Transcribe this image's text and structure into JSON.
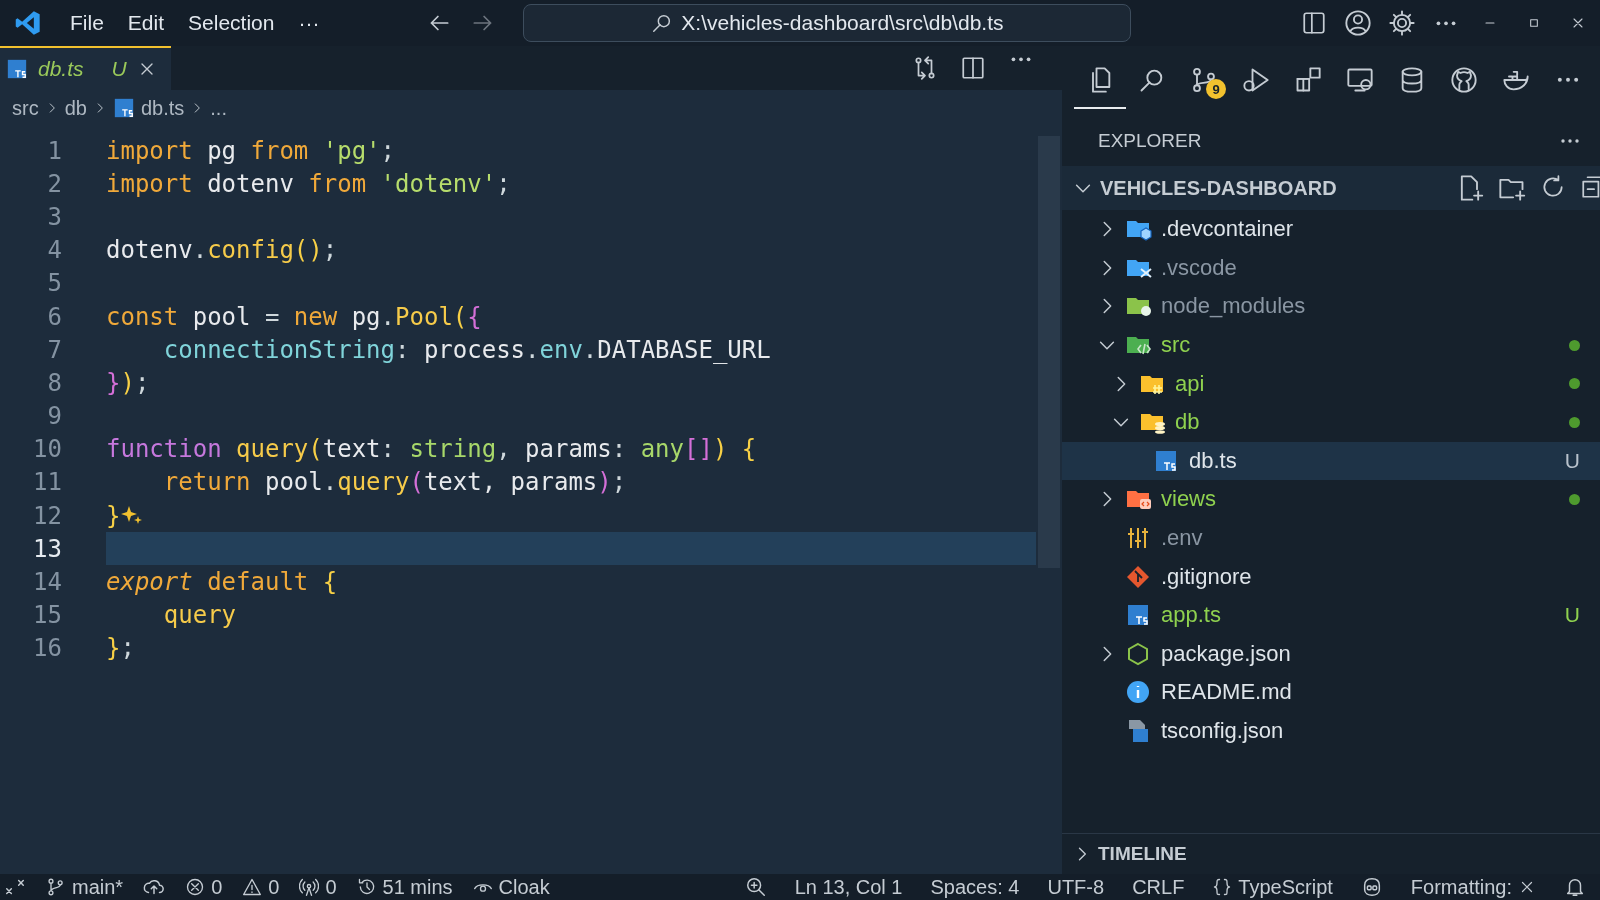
{
  "titlebar": {
    "menus": [
      "File",
      "Edit",
      "Selection",
      "···"
    ],
    "command_center": "X:\\vehicles-dashboard\\src\\db\\db.ts"
  },
  "tabs": [
    {
      "label": "db.ts",
      "badge": "U",
      "selected": true
    }
  ],
  "breadcrumbs": [
    "src",
    "db",
    "db.ts",
    "..."
  ],
  "editor": {
    "lines": [
      {
        "n": "1",
        "current": false,
        "sparkle": false,
        "tokens": [
          {
            "t": "import",
            "kind": "kw"
          },
          {
            "t": " pg ",
            "kind": "id"
          },
          {
            "t": "from",
            "kind": "kw"
          },
          {
            "t": " 'pg'",
            "kind": "str"
          },
          {
            "t": ";",
            "kind": "punct"
          }
        ]
      },
      {
        "n": "2",
        "current": false,
        "sparkle": false,
        "tokens": [
          {
            "t": "import",
            "kind": "kw"
          },
          {
            "t": " dotenv ",
            "kind": "id"
          },
          {
            "t": "from",
            "kind": "kw"
          },
          {
            "t": " 'dotenv'",
            "kind": "str"
          },
          {
            "t": ";",
            "kind": "punct"
          }
        ]
      },
      {
        "n": "3",
        "current": false,
        "sparkle": false
      },
      {
        "n": "4",
        "current": false,
        "sparkle": false,
        "tokens": [
          {
            "t": "dotenv",
            "kind": "id"
          },
          {
            "t": ".",
            "kind": "punct"
          },
          {
            "t": "config",
            "kind": "fn"
          },
          {
            "t": "()",
            "kind": "br1"
          },
          {
            "t": ";",
            "kind": "punct"
          }
        ]
      },
      {
        "n": "5",
        "current": false,
        "sparkle": false
      },
      {
        "n": "6",
        "current": false,
        "sparkle": false,
        "tokens": [
          {
            "t": "const",
            "kind": "kw"
          },
          {
            "t": " pool ",
            "kind": "id"
          },
          {
            "t": "= ",
            "kind": "punct"
          },
          {
            "t": "new",
            "kind": "kw"
          },
          {
            "t": " pg",
            "kind": "id"
          },
          {
            "t": ".",
            "kind": "punct"
          },
          {
            "t": "Pool",
            "kind": "fn"
          },
          {
            "t": "(",
            "kind": "br1"
          },
          {
            "t": "{",
            "kind": "br2"
          }
        ]
      },
      {
        "n": "7",
        "current": false,
        "sparkle": false,
        "tokens": [
          {
            "t": "    connectionString",
            "kind": "prop"
          },
          {
            "t": ": ",
            "kind": "punct"
          },
          {
            "t": "process",
            "kind": "id"
          },
          {
            "t": ".",
            "kind": "punct"
          },
          {
            "t": "env",
            "kind": "prop"
          },
          {
            "t": ".",
            "kind": "punct"
          },
          {
            "t": "DATABASE_URL",
            "kind": "id"
          }
        ]
      },
      {
        "n": "8",
        "current": false,
        "sparkle": false,
        "tokens": [
          {
            "t": "}",
            "kind": "br2"
          },
          {
            "t": ")",
            "kind": "br1"
          },
          {
            "t": ";",
            "kind": "punct"
          }
        ]
      },
      {
        "n": "9",
        "current": false,
        "sparkle": false
      },
      {
        "n": "10",
        "current": false,
        "sparkle": false,
        "tokens": [
          {
            "t": "function ",
            "kind": "fkw"
          },
          {
            "t": "query",
            "kind": "fn"
          },
          {
            "t": "(",
            "kind": "br1"
          },
          {
            "t": "text",
            "kind": "id"
          },
          {
            "t": ": ",
            "kind": "punct"
          },
          {
            "t": "string",
            "kind": "type"
          },
          {
            "t": ", ",
            "kind": "punct"
          },
          {
            "t": "params",
            "kind": "id"
          },
          {
            "t": ": ",
            "kind": "punct"
          },
          {
            "t": "any",
            "kind": "type"
          },
          {
            "t": "[]",
            "kind": "br2"
          },
          {
            "t": ") {",
            "kind": "br1"
          }
        ]
      },
      {
        "n": "11",
        "current": false,
        "sparkle": false,
        "tokens": [
          {
            "t": "    return",
            "kind": "kw"
          },
          {
            "t": " pool",
            "kind": "id"
          },
          {
            "t": ".",
            "kind": "punct"
          },
          {
            "t": "query",
            "kind": "fn"
          },
          {
            "t": "(",
            "kind": "br2"
          },
          {
            "t": "text, params",
            "kind": "id"
          },
          {
            "t": ")",
            "kind": "br2"
          },
          {
            "t": ";",
            "kind": "punct"
          }
        ]
      },
      {
        "n": "12",
        "current": false,
        "sparkle": true,
        "tokens": [
          {
            "t": "}",
            "kind": "br1"
          }
        ]
      },
      {
        "n": "13",
        "current": true,
        "sparkle": false
      },
      {
        "n": "14",
        "current": false,
        "sparkle": false,
        "tokens": [
          {
            "t": "export",
            "kind": "kwi"
          },
          {
            "t": " default ",
            "kind": "kw"
          },
          {
            "t": "{",
            "kind": "br1"
          }
        ]
      },
      {
        "n": "15",
        "current": false,
        "sparkle": false,
        "tokens": [
          {
            "t": "    query",
            "kind": "fn"
          }
        ]
      },
      {
        "n": "16",
        "current": false,
        "sparkle": false,
        "tokens": [
          {
            "t": "}",
            "kind": "br1"
          },
          {
            "t": ";",
            "kind": "punct"
          }
        ]
      }
    ]
  },
  "activity_bar": [
    {
      "kind": "files",
      "selected": true
    },
    {
      "kind": "search",
      "selected": false
    },
    {
      "kind": "scm",
      "selected": false,
      "badge": "9"
    },
    {
      "kind": "debug",
      "selected": false
    },
    {
      "kind": "extensions",
      "selected": false
    },
    {
      "kind": "remote",
      "selected": false
    },
    {
      "kind": "database",
      "selected": false
    },
    {
      "kind": "cat",
      "selected": false
    },
    {
      "kind": "whale",
      "selected": false
    },
    {
      "kind": "more",
      "selected": false
    }
  ],
  "explorer": {
    "title": "EXPLORER",
    "folder": "VEHICLES-DASHBOARD",
    "expanded": true,
    "timeline": "TIMELINE",
    "tree": [
      {
        "name": ".devcontainer",
        "kind": "devfolder",
        "expanded": false,
        "selected": false,
        "color": "#dfe5ea",
        "dot": false
      },
      {
        "name": ".vscode",
        "kind": "vscodefolder",
        "expanded": false,
        "selected": false,
        "color": "#8a96a3",
        "dot": false
      },
      {
        "name": "node_modules",
        "kind": "nodefolder",
        "expanded": false,
        "selected": false,
        "color": "#8a96a3",
        "dot": false
      },
      {
        "name": "src",
        "kind": "srcfolder",
        "expanded": true,
        "selected": false,
        "color": "#8fd14f",
        "dot": true,
        "children": [
          {
            "name": "api",
            "kind": "apifolder",
            "expanded": false,
            "selected": false,
            "color": "#8fd14f",
            "dot": true
          },
          {
            "name": "db",
            "kind": "dbfolder",
            "expanded": true,
            "selected": false,
            "color": "#8fd14f",
            "dot": true,
            "children": [
              {
                "name": "db.ts",
                "kind": "tsfile",
                "selected": true,
                "color": "#dfe5ea",
                "dot": false,
                "badge": "U"
              }
            ]
          }
        ]
      },
      {
        "name": "views",
        "kind": "viewsfolder",
        "expanded": false,
        "selected": false,
        "color": "#8fd14f",
        "dot": true
      },
      {
        "name": ".env",
        "kind": "envfile",
        "selected": false,
        "color": "#8a96a3",
        "dot": false
      },
      {
        "name": ".gitignore",
        "kind": "gitfile",
        "selected": false,
        "color": "#dfe5ea",
        "dot": false
      },
      {
        "name": "app.ts",
        "kind": "tsfile",
        "selected": false,
        "color": "#8fd14f",
        "dot": false,
        "badge": "U"
      },
      {
        "name": "package.json",
        "kind": "package",
        "expanded": false,
        "selected": false,
        "color": "#dfe5ea",
        "dot": false
      },
      {
        "name": "README.md",
        "kind": "infofile",
        "selected": false,
        "color": "#dfe5ea",
        "dot": false
      },
      {
        "name": "tsconfig.json",
        "kind": "configfile",
        "selected": false,
        "color": "#dfe5ea",
        "dot": false
      }
    ]
  },
  "status_bar": {
    "left": [
      {
        "kind": "remote"
      },
      {
        "kind": "branch",
        "text": "main*"
      },
      {
        "kind": "sync"
      },
      {
        "kind": "errors",
        "text": "0"
      },
      {
        "kind": "warnings",
        "text": "0"
      },
      {
        "kind": "ports",
        "text": "0"
      },
      {
        "kind": "history",
        "text": "51 mins"
      },
      {
        "kind": "eye",
        "text": "Cloak"
      }
    ],
    "right": [
      {
        "kind": "zoom"
      },
      {
        "kind": "text",
        "text": "Ln 13, Col 1"
      },
      {
        "kind": "text",
        "text": "Spaces: 4"
      },
      {
        "kind": "text",
        "text": "UTF-8"
      },
      {
        "kind": "text",
        "text": "CRLF"
      },
      {
        "kind": "braces",
        "text": "TypeScript"
      },
      {
        "kind": "copilot"
      },
      {
        "kind": "closable",
        "text": "Formatting:"
      },
      {
        "kind": "bell"
      }
    ]
  }
}
